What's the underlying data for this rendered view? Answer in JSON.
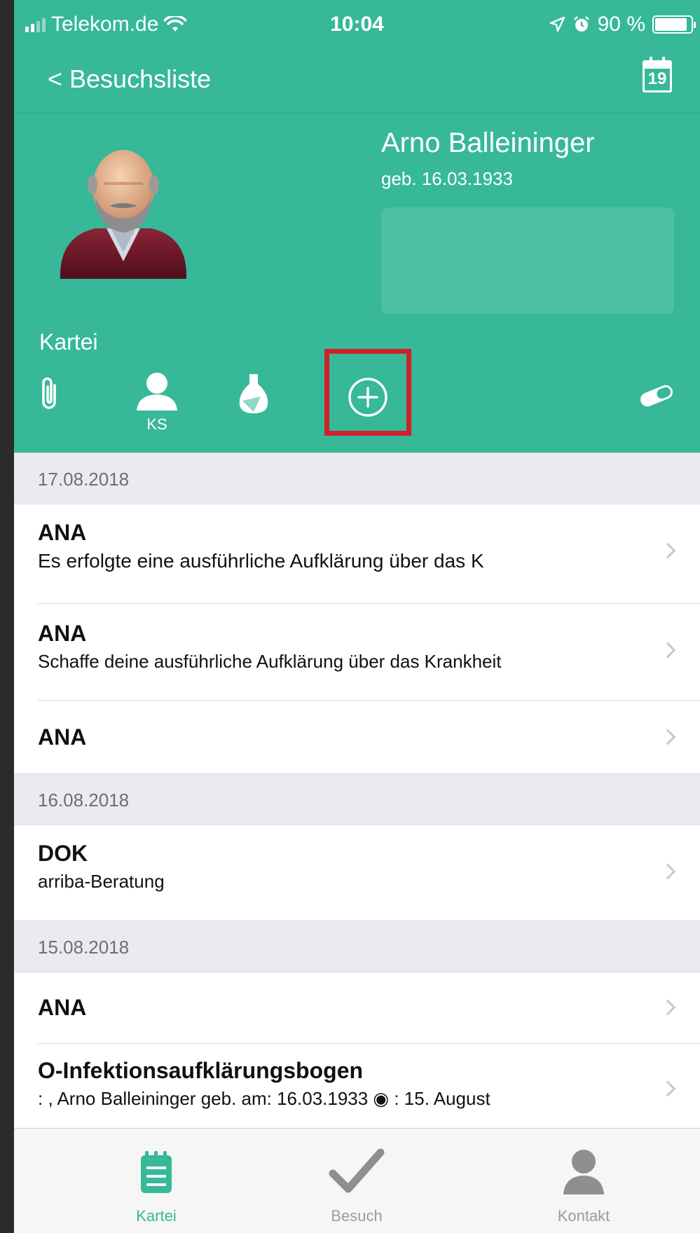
{
  "status_bar": {
    "carrier": "Telekom.de",
    "time": "10:04",
    "battery": "90 %",
    "battery_level": 0.9
  },
  "nav": {
    "back_label": "< Besuchsliste",
    "calendar_day": "19"
  },
  "patient": {
    "name": "Arno Balleininger",
    "dob": "geb. 16.03.1933"
  },
  "section_label": "Kartei",
  "icon_bar": {
    "person_badge": "KS"
  },
  "list": {
    "section1": {
      "date": "17.08.2018"
    },
    "row1": {
      "title": "ANA",
      "subtitle": "Es erfolgte eine ausführliche Aufklärung über das K"
    },
    "row2": {
      "title": "ANA",
      "subtitle": "Schaffe deine ausführliche Aufklärung über das Krankheit"
    },
    "row3": {
      "title": "ANA"
    },
    "section2": {
      "date": "16.08.2018"
    },
    "row4": {
      "title": "DOK",
      "subtitle": "arriba-Beratung"
    },
    "section3": {
      "date": "15.08.2018"
    },
    "row5": {
      "title": "ANA"
    },
    "row6": {
      "title": "O-Infektionsaufklärungsbogen",
      "subtitle": ": , Arno Balleininger   geb. am:  16.03.1933  ◉ : 15. August"
    }
  },
  "tabs": {
    "kartei": "Kartei",
    "besuch": "Besuch",
    "kontakt": "Kontakt"
  },
  "colors": {
    "brand_green": "#36b899",
    "highlight_red": "#d0202b"
  }
}
